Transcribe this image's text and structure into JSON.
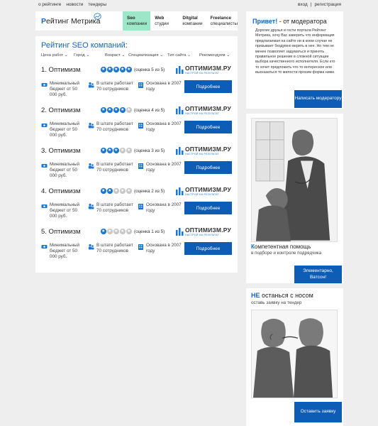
{
  "top_links": [
    "о рейтинге",
    "новости",
    "тендеры"
  ],
  "auth": {
    "login": "вход",
    "separator": "|",
    "register": "регистрация"
  },
  "logo": {
    "letter": "Р",
    "rest": "ейтинг Метрика"
  },
  "nav": [
    {
      "title": "Seo",
      "sub": "компании",
      "active": true
    },
    {
      "title": "Web",
      "sub": "студии",
      "active": false
    },
    {
      "title": "Ditgital",
      "sub": "компании",
      "active": false
    },
    {
      "title": "Freelance",
      "sub": "специалисты",
      "active": false
    }
  ],
  "main": {
    "title": "Рейтинг SEO компаний:",
    "filters": [
      "Цена работ",
      "Город",
      "Возраст",
      "Специализация",
      "Тип сайта",
      "Рекомендуем"
    ],
    "more_label": "Подробнее",
    "companies": [
      {
        "name": "1. Оптимизм",
        "stars": 5,
        "rating": "(оценка 5 из 5)",
        "brand": "ОПТИМИЗМ.РУ",
        "brand_sub": "НАСТРОЙ НА РЕЗУЛЬТАТ",
        "budget": "Минимальный бюджет от 50 000 руб.",
        "staff": "В штате работает 70 сотрудников",
        "founded": "Основана в 2007 году"
      },
      {
        "name": "2. Оптимизм",
        "stars": 4,
        "rating": "(оценка 4 из 5)",
        "brand": "ОПТИМИЗМ.РУ",
        "brand_sub": "НАСТРОЙ НА РЕЗУЛЬТАТ",
        "budget": "Минимальный бюджет от 50 000 руб.",
        "staff": "В штате работает 70 сотрудников",
        "founded": "Основана в 2007 году"
      },
      {
        "name": "3. Оптимизм",
        "stars": 3,
        "rating": "(оценка 3 из 5)",
        "brand": "ОПТИМИЗМ.РУ",
        "brand_sub": "НАСТРОЙ НА РЕЗУЛЬТАТ",
        "budget": "Минимальный бюджет от 50 000 руб.",
        "staff": "В штате работает 70 сотрудников",
        "founded": "Основана в 2007 году"
      },
      {
        "name": "4. Оптимизм",
        "stars": 2,
        "rating": "(оценка 2 из 5)",
        "brand": "ОПТИМИЗМ.РУ",
        "brand_sub": "НАСТРОЙ НА РЕЗУЛЬТАТ",
        "budget": "Минимальный бюджет от 50 000 руб.",
        "staff": "В штате работает 70 сотрудников",
        "founded": "Основана в 2007 году"
      },
      {
        "name": "5. Оптимизм",
        "stars": 1,
        "rating": "(оценка 1 из 5)",
        "brand": "ОПТИМИЗМ.РУ",
        "brand_sub": "НАСТРОЙ НА РЕЗУЛЬТАТ",
        "budget": "Минимальный бюджет от 50 000 руб.",
        "staff": "В штате работает 70 сотрудников",
        "founded": "Основана в 2007 году"
      }
    ]
  },
  "sidebar": {
    "greeting": {
      "hi": "Привет!",
      "rest": " - от модератора",
      "text": "Дорогие друзья и гости портала Рейтинг Метрика, хочу Вас заверить что информация предлагаемая на сайте ни в коем случае не призывает бездумно верить в нее. Но тем не менее позволяет задуматься и принять правильное решение в сложной ситуации выбора качественного исполнителя. Если кто то хочет предложить что то интересное или высказаться то милости просим форма ниже.",
      "button": "Написать модератору"
    },
    "help": {
      "first": "К",
      "title_rest": "омпетентная помощь",
      "sub": "в подборе и контроле подрядчика",
      "button": "Элементарно, Ватсон!"
    },
    "tender": {
      "first": "НЕ",
      "title_rest": " останься с носом",
      "sub": "оставь заявку на тендер",
      "button": "Оставить заявку"
    }
  },
  "colors": {
    "accent": "#0d5cb6",
    "active_tab": "#9be7c7",
    "star_on": "#1976d2",
    "star_off": "#c8c8c8"
  }
}
